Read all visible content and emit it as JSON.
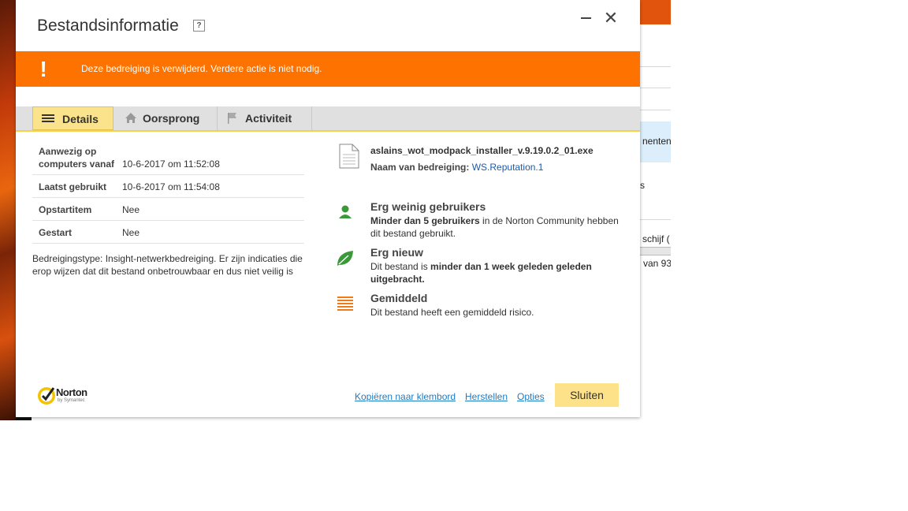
{
  "background": {
    "text_1": "nenten",
    "text_2": "s",
    "text_3": "schijf (",
    "text_4": "van 93"
  },
  "dialog": {
    "title": "Bestandsinformatie",
    "help_label": "?",
    "close_glyph": "✕",
    "alert_icon": "!",
    "alert_text": "Deze bedreiging is verwijderd. Verdere actie is niet nodig."
  },
  "tabs": [
    {
      "label": "Details",
      "icon": "hamburger-icon",
      "active": true
    },
    {
      "label": "Oorsprong",
      "icon": "home-icon"
    },
    {
      "label": "Activiteit",
      "icon": "flag-icon"
    }
  ],
  "details": [
    {
      "label_line1": "Aanwezig op",
      "label_line2": "computers vanaf",
      "value": "10-6-2017 om 11:52:08"
    },
    {
      "label": "Laatst gebruikt",
      "value": "10-6-2017 om 11:54:08"
    },
    {
      "label": "Opstartitem",
      "value": "Nee"
    },
    {
      "label": "Gestart",
      "value": "Nee"
    }
  ],
  "description": "Bedreigingstype: Insight-netwerkbedreiging. Er zijn indicaties die erop wijzen dat dit bestand onbetrouwbaar en dus niet veilig is",
  "file": {
    "name": "aslains_wot_modpack_installer_v.9.19.0.2_01.exe",
    "threat_label": "Naam van bedreiging:",
    "threat_name": "WS.Reputation.1"
  },
  "ratings": [
    {
      "icon": "user-icon",
      "color": "#3a9a3a",
      "title": "Erg weinig gebruikers",
      "bold": "Minder dan 5 gebruikers",
      "text": " in de Norton Community hebben dit bestand gebruikt."
    },
    {
      "icon": "leaf-icon",
      "color": "#3a9a3a",
      "title": "Erg nieuw",
      "text_pre": "Dit bestand is ",
      "bold": "minder dan 1 week geleden geleden uitgebracht."
    },
    {
      "icon": "risk-bars-icon",
      "color": "#f07a18",
      "title": "Gemiddeld",
      "text": "Dit bestand heeft een gemiddeld risico."
    }
  ],
  "footer": {
    "logo_text": "Norton",
    "logo_sub": "by Symantec",
    "link_copy": "Kopiëren naar klembord",
    "link_restore": "Herstellen",
    "link_options": "Opties",
    "close_label": "Sluiten"
  },
  "colors": {
    "alert": "#fe7300",
    "active_tab": "#fbe38b",
    "link": "#1e7bc4",
    "button": "#fde28a"
  }
}
